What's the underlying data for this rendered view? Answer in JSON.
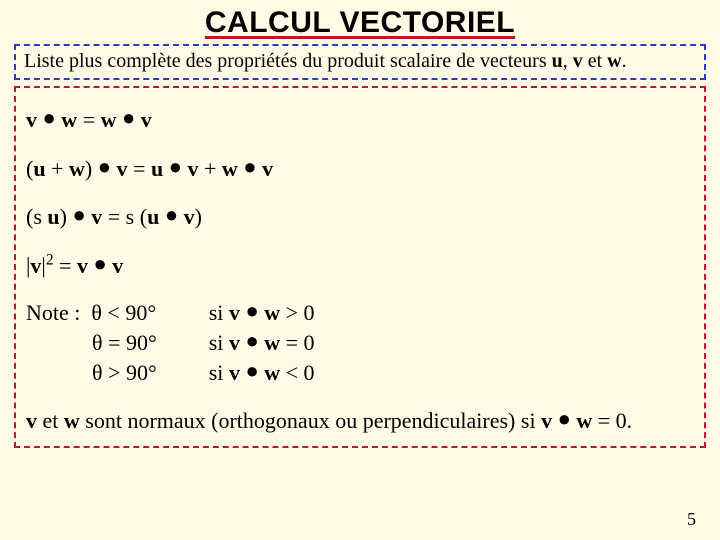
{
  "title": "CALCUL VECTORIEL",
  "intro": {
    "pre": "Liste plus complète des propriétés du produit scalaire de vecteurs ",
    "u": "u",
    "sep1": ", ",
    "v": "v",
    "sep2": " et ",
    "w": "w",
    "end": "."
  },
  "prop1": {
    "v1": "v",
    "d1": " ● ",
    "w1": "w",
    "eq": " = ",
    "w2": "w",
    "d2": " ● ",
    "v2": "v"
  },
  "prop2": {
    "lp": "(",
    "u": "u",
    "pl": " + ",
    "w": "w",
    "rp": ") ",
    "d1": "● ",
    "v1": "v",
    "eq": " = ",
    "u2": "u",
    "d2": " ● ",
    "v2": "v",
    "pl2": " + ",
    "w2": "w",
    "d3": " ● ",
    "v3": "v"
  },
  "prop3": {
    "lp": "(s ",
    "u": "u",
    "rp": ") ",
    "d1": "● ",
    "v1": "v",
    "eq": " = s (",
    "u2": "u",
    "d2": " ● ",
    "v2": "v",
    "rp2": ")"
  },
  "prop4": {
    "bar1": "|",
    "v": "v",
    "bar2": "|",
    "exp": "2",
    "eq": " = ",
    "v2": "v",
    "d": " ● ",
    "v3": "v"
  },
  "note": {
    "label": "Note :  ",
    "l1": "θ < 90°",
    "l2": "θ = 90°",
    "l3": "θ > 90°",
    "c1": {
      "pre": "si ",
      "v": "v",
      "d": " ● ",
      "w": "w",
      "rel": " > 0"
    },
    "c2": {
      "pre": "si ",
      "v": "v",
      "d": " ● ",
      "w": "w",
      "rel": " = 0"
    },
    "c3": {
      "pre": "si ",
      "v": "v",
      "d": " ● ",
      "w": "w",
      "rel": " < 0"
    }
  },
  "final": {
    "v": "v",
    "and": " et ",
    "w": "w",
    "txt": " sont normaux (orthogonaux ou perpendiculaires) si ",
    "v2": "v",
    "d": " ● ",
    "w2": "w",
    "eq": " = 0."
  },
  "pagenum": "5"
}
